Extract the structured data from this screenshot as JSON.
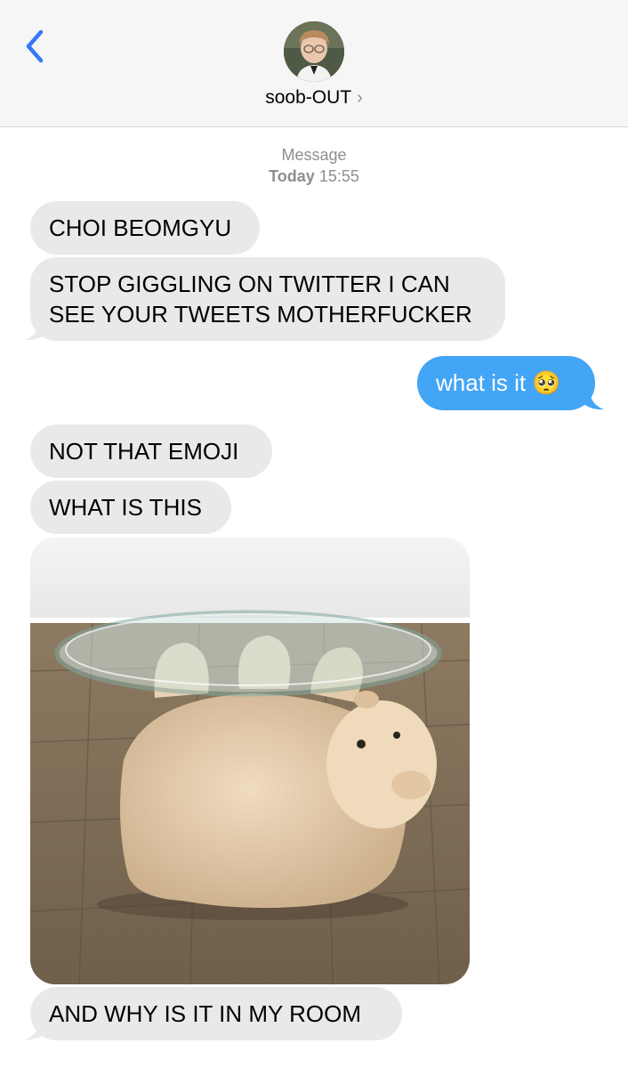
{
  "header": {
    "contact_name": "soob-OUT",
    "chevron": "›",
    "back_icon": "chevron-left-icon",
    "accent_color": "#3478f6"
  },
  "meta": {
    "service": "Message",
    "day": "Today",
    "time": "15:55"
  },
  "messages": [
    {
      "direction": "in",
      "text": "CHOI BEOMGYU"
    },
    {
      "direction": "in",
      "line1": "STOP GIGGLING ON TWITTER I CAN",
      "line2": "SEE YOUR TWEETS MOTHERFUCKER"
    },
    {
      "direction": "out",
      "text": "what is it",
      "emoji": "🥺"
    },
    {
      "direction": "in",
      "text": "NOT THAT EMOJI"
    },
    {
      "direction": "in",
      "text": "WHAT IS THIS"
    },
    {
      "direction": "in",
      "type": "image",
      "image_subject": "glass-top table with polar bear sculpture base"
    },
    {
      "direction": "in",
      "text": "AND WHY IS IT IN MY ROOM"
    }
  ],
  "colors": {
    "incoming_bubble": "#e9e9eb",
    "outgoing_bubble": "#43a5f5"
  }
}
